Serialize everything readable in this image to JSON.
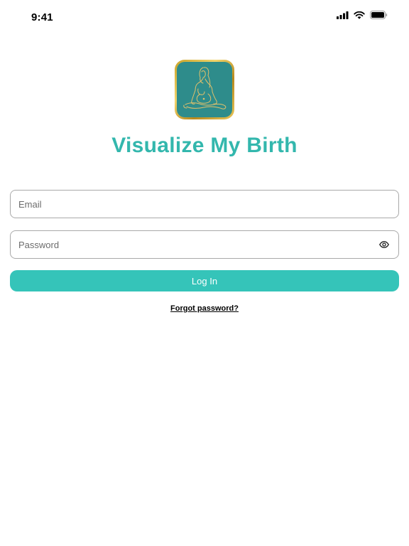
{
  "status_bar": {
    "time": "9:41"
  },
  "icons": {
    "signal": "cellular-signal-icon",
    "wifi": "wifi-icon",
    "battery": "battery-icon",
    "logo": "meditating-woman-logo",
    "password_toggle": "eye-icon"
  },
  "app": {
    "title": "Visualize My Birth"
  },
  "form": {
    "email_placeholder": "Email",
    "email_value": "",
    "password_placeholder": "Password",
    "password_value": "",
    "login_label": "Log In",
    "forgot_label": "Forgot password?"
  },
  "colors": {
    "brand": "#33b7ad",
    "button": "#35c4b9",
    "logo_background": "#2e8c8b",
    "logo_border": "#d4af37"
  }
}
